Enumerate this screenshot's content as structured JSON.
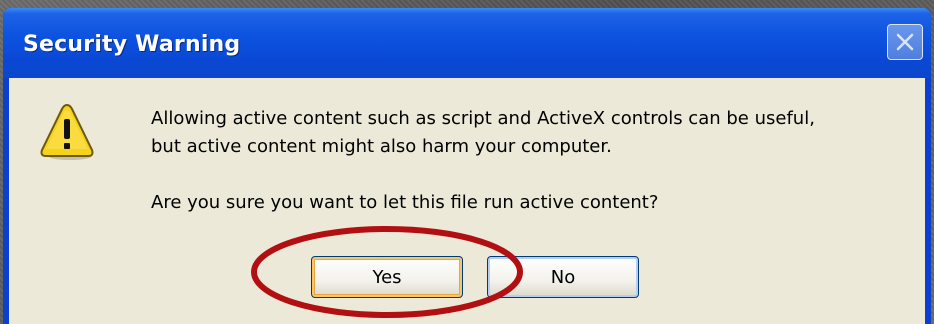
{
  "dialog": {
    "title": "Security Warning",
    "close_icon": "close-icon",
    "warning_icon": "warning-icon"
  },
  "message": {
    "line1": "Allowing active content such as script and ActiveX controls can be useful,",
    "line2": "but active content might also harm your computer.",
    "question": "Are you sure you want to let this file run active content?"
  },
  "buttons": {
    "yes_label": "Yes",
    "no_label": "No"
  },
  "annotation": {
    "shape": "ellipse",
    "target": "yes-button",
    "color": "#b10f12"
  },
  "colors": {
    "titlebar": "#0a48d4",
    "dialog_body": "#ece9d8",
    "default_button_focus": "#e9a640",
    "warning_yellow": "#f7d21a"
  }
}
